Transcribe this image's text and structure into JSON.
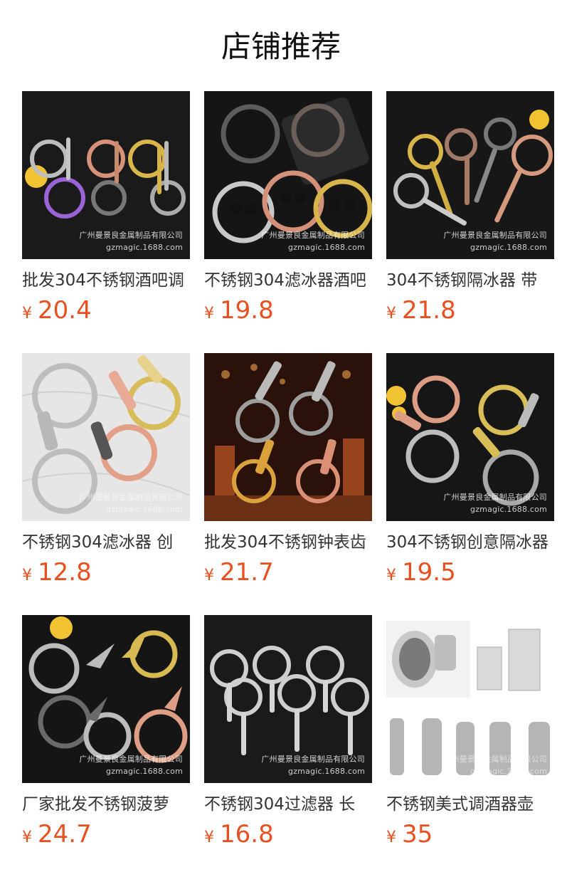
{
  "header": {
    "title": "店铺推荐"
  },
  "watermark": {
    "line1": "广州曼景良金属制品有限公司",
    "line2": "gzmagic.1688.com"
  },
  "currency": "¥",
  "products": [
    {
      "name": "批发304不锈钢酒吧调",
      "price": "20.4",
      "image": "skull-strainers-rainbow"
    },
    {
      "name": "不锈钢304滤冰器酒吧",
      "price": "19.8",
      "image": "skull-strainers"
    },
    {
      "name": "304不锈钢隔冰器 带",
      "price": "21.8",
      "image": "ornate-strainers"
    },
    {
      "name": "不锈钢304滤冰器 创",
      "price": "12.8",
      "image": "perforated-strainers"
    },
    {
      "name": "批发304不锈钢钟表齿",
      "price": "21.7",
      "image": "clock-strainers-bar"
    },
    {
      "name": "304不锈钢创意隔冰器",
      "price": "19.5",
      "image": "wheel-strainers"
    },
    {
      "name": "厂家批发不锈钢菠萝",
      "price": "24.7",
      "image": "pineapple-strainers"
    },
    {
      "name": "不锈钢304过滤器 长",
      "price": "16.8",
      "image": "long-handle-strainers"
    },
    {
      "name": "不锈钢美式调酒器壶",
      "price": "35",
      "image": "cocktail-shakers"
    }
  ]
}
